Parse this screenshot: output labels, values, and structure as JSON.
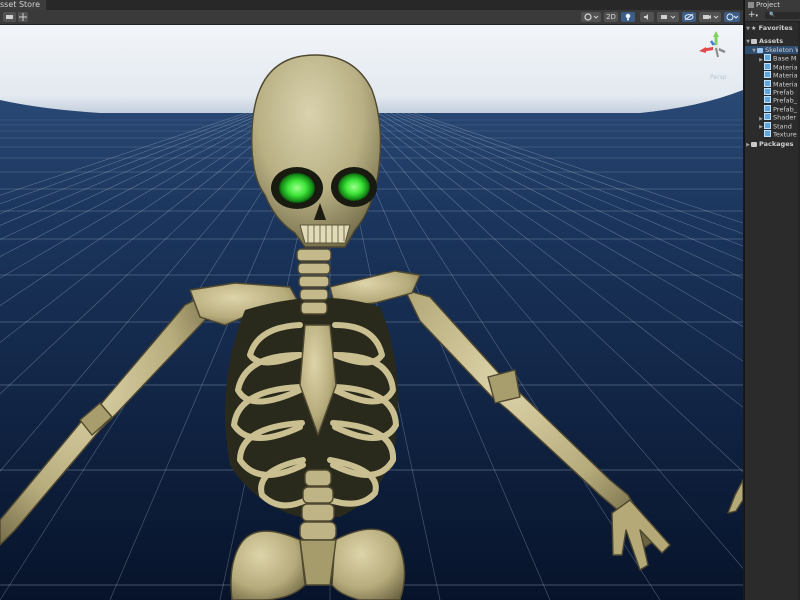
{
  "scene": {
    "tab_label": "sset Store",
    "toolbar": {
      "mode_2d_label": "2D",
      "more_label": "⋮"
    }
  },
  "gizmo": {
    "projection_label": "Persp"
  },
  "project": {
    "tab_label": "Project",
    "add_label": "+",
    "add_arrow": "▾",
    "search_placeholder": "🔍",
    "favorites_label": "Favorites",
    "assets_label": "Assets",
    "skeleton_label": "Skeleton W",
    "folders": [
      {
        "label": "Base M",
        "has_arrow": true
      },
      {
        "label": "Materia",
        "has_arrow": false
      },
      {
        "label": "Materia",
        "has_arrow": false
      },
      {
        "label": "Materia",
        "has_arrow": false
      },
      {
        "label": "Prefab",
        "has_arrow": false
      },
      {
        "label": "Prefab_",
        "has_arrow": false
      },
      {
        "label": "Prefab_",
        "has_arrow": false
      },
      {
        "label": "Shader",
        "has_arrow": true
      },
      {
        "label": "Stand",
        "has_arrow": true
      },
      {
        "label": "Texture",
        "has_arrow": false
      }
    ],
    "packages_label": "Packages"
  },
  "colors": {
    "sky_top": "#f0f4f8",
    "horizon": "#8ea6bf",
    "floor_far": "#1d3a63",
    "floor_near": "#08142a",
    "grid_line": "#d6e2ee",
    "bone": "#cfc59a",
    "bone_dark": "#6d6442",
    "eye_glow": "#3cf03a",
    "selection": "#2f4d70"
  }
}
